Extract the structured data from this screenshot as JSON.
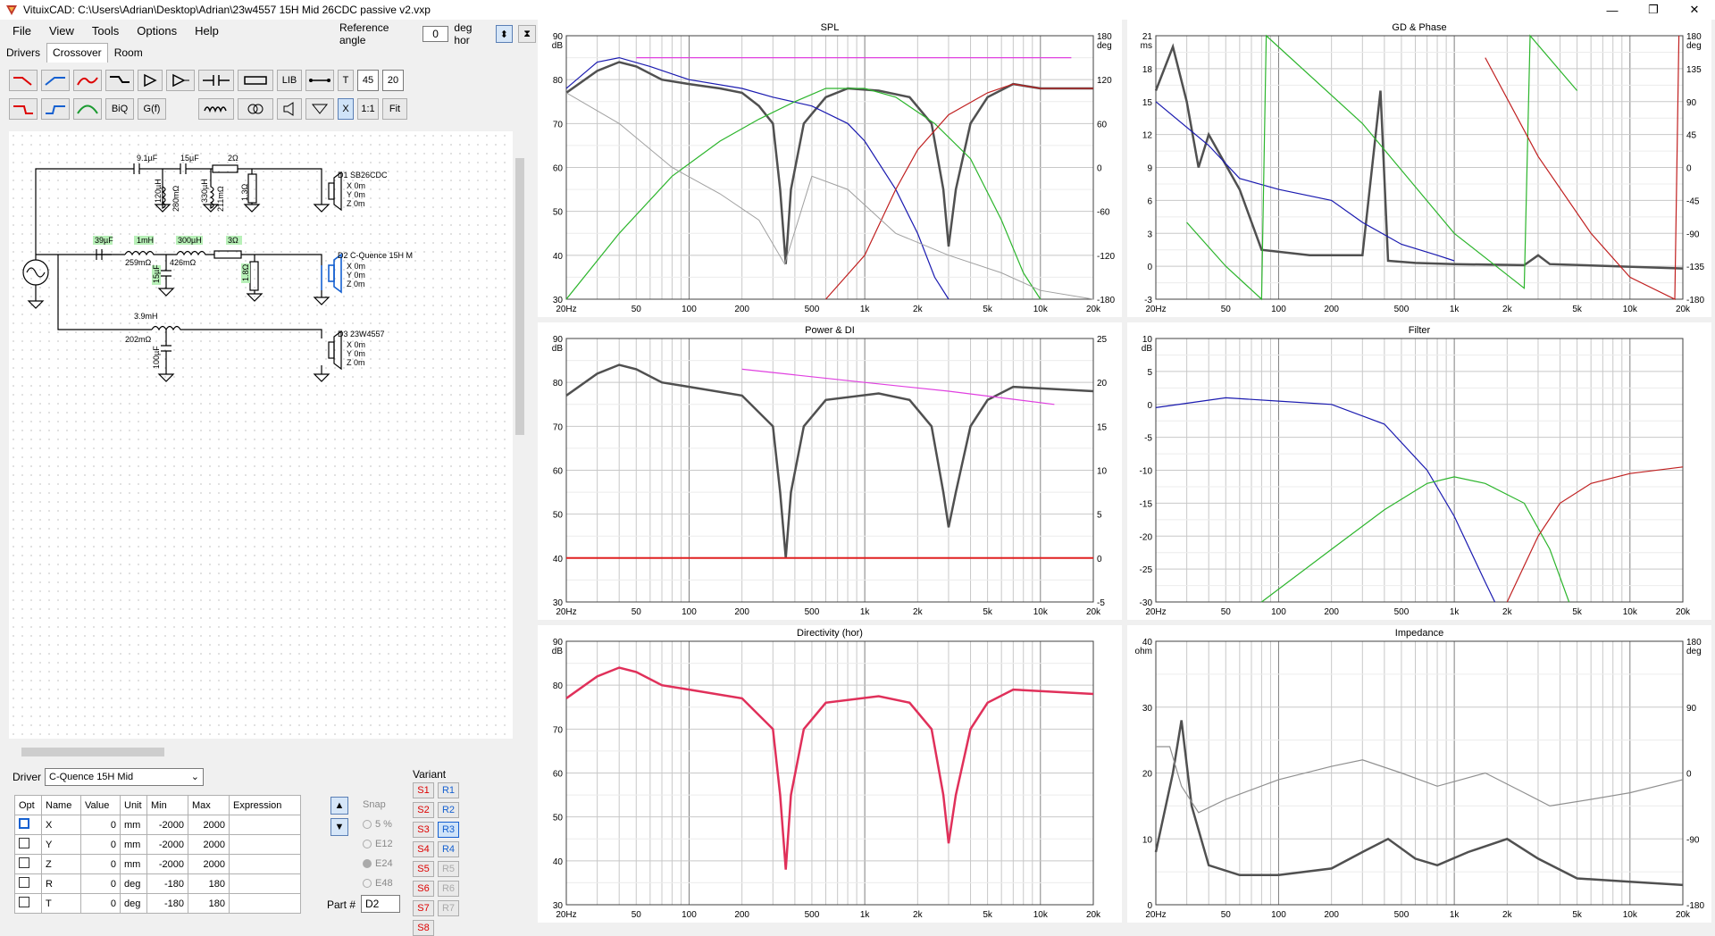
{
  "window": {
    "title": "VituixCAD: C:\\Users\\Adrian\\Desktop\\Adrian\\23w4557 15H Mid 26CDC passive v2.vxp",
    "controls": [
      "—",
      "❐",
      "✕"
    ]
  },
  "menu": [
    "File",
    "View",
    "Tools",
    "Options",
    "Help"
  ],
  "reference_angle": {
    "label": "Reference angle",
    "value": "0",
    "unit": "deg hor"
  },
  "tabs": [
    "Drivers",
    "Crossover",
    "Room"
  ],
  "toolbar": {
    "lib": "LIB",
    "t": "T",
    "val1": "45",
    "val2": "20",
    "biq": "BiQ",
    "gf": "G(f)",
    "x": "X",
    "one_to_one": "1:1",
    "fit": "Fit"
  },
  "schematic": {
    "components": [
      "9.1µF",
      "15µF",
      "2Ω",
      "120µH",
      "280mΩ",
      "330µH",
      "211mΩ",
      "1.3Ω",
      "39µF",
      "1mH",
      "259mΩ",
      "300µH",
      "426mΩ",
      "3Ω",
      "15µF",
      "1.8Ω",
      "3.9mH",
      "202mΩ",
      "100µF"
    ],
    "drivers": [
      {
        "name": "D1 SB26CDC",
        "x": "X 0m",
        "y": "Y 0m",
        "z": "Z 0m"
      },
      {
        "name": "D2 C-Quence 15H M",
        "x": "X 0m",
        "y": "Y 0m",
        "z": "Z 0m"
      },
      {
        "name": "D3 23W4557",
        "x": "X 0m",
        "y": "Y 0m",
        "z": "Z 0m"
      }
    ]
  },
  "driver_panel": {
    "label": "Driver",
    "selected": "C-Quence 15H Mid",
    "headers": [
      "Opt",
      "Name",
      "Value",
      "Unit",
      "Min",
      "Max",
      "Expression"
    ],
    "rows": [
      {
        "name": "X",
        "value": "0",
        "unit": "mm",
        "min": "-2000",
        "max": "2000"
      },
      {
        "name": "Y",
        "value": "0",
        "unit": "mm",
        "min": "-2000",
        "max": "2000"
      },
      {
        "name": "Z",
        "value": "0",
        "unit": "mm",
        "min": "-2000",
        "max": "2000"
      },
      {
        "name": "R",
        "value": "0",
        "unit": "deg",
        "min": "-180",
        "max": "180"
      },
      {
        "name": "T",
        "value": "0",
        "unit": "deg",
        "min": "-180",
        "max": "180"
      }
    ],
    "snap": {
      "label": "Snap",
      "options": [
        "5 %",
        "E12",
        "E24",
        "E48"
      ]
    },
    "part_label": "Part #",
    "part_value": "D2",
    "variant_label": "Variant",
    "variants_s": [
      "S1",
      "S2",
      "S3",
      "S4",
      "S5",
      "S6",
      "S7",
      "S8"
    ],
    "variants_r": [
      "R1",
      "R2",
      "R3",
      "R4",
      "R5",
      "R6",
      "R7",
      "R8"
    ]
  },
  "graphs": {
    "x_ticks": [
      "20Hz",
      "50",
      "100",
      "200",
      "500",
      "1k",
      "2k",
      "5k",
      "10k",
      "20k"
    ],
    "spl": {
      "title": "SPL",
      "left_unit": "dB",
      "right_unit": "deg",
      "left_ticks": [
        "90",
        "80",
        "70",
        "60",
        "50",
        "40",
        "30"
      ],
      "right_ticks": [
        "180",
        "120",
        "60",
        "0",
        "-60",
        "-120",
        "-180"
      ]
    },
    "gd": {
      "title": "GD & Phase",
      "left_unit": "ms",
      "right_unit": "deg",
      "left_ticks": [
        "21",
        "18",
        "15",
        "12",
        "9",
        "6",
        "3",
        "0",
        "-3"
      ],
      "right_ticks": [
        "180",
        "135",
        "90",
        "45",
        "0",
        "-45",
        "-90",
        "-135",
        "-180"
      ]
    },
    "power": {
      "title": "Power & DI",
      "left_unit": "dB",
      "left_ticks": [
        "90",
        "80",
        "70",
        "60",
        "50",
        "40",
        "30"
      ],
      "right_ticks": [
        "25",
        "20",
        "15",
        "10",
        "5",
        "0",
        "-5"
      ]
    },
    "filter": {
      "title": "Filter",
      "left_unit": "dB",
      "left_ticks": [
        "10",
        "5",
        "0",
        "-5",
        "-10",
        "-15",
        "-20",
        "-25",
        "-30"
      ]
    },
    "directivity": {
      "title": "Directivity (hor)",
      "left_unit": "dB",
      "left_ticks": [
        "90",
        "80",
        "70",
        "60",
        "50",
        "40",
        "30"
      ]
    },
    "impedance": {
      "title": "Impedance",
      "left_unit": "ohm",
      "right_unit": "deg",
      "left_ticks": [
        "40",
        "30",
        "20",
        "10",
        "0"
      ],
      "right_ticks": [
        "180",
        "90",
        "0",
        "-90",
        "-180"
      ]
    }
  }
}
